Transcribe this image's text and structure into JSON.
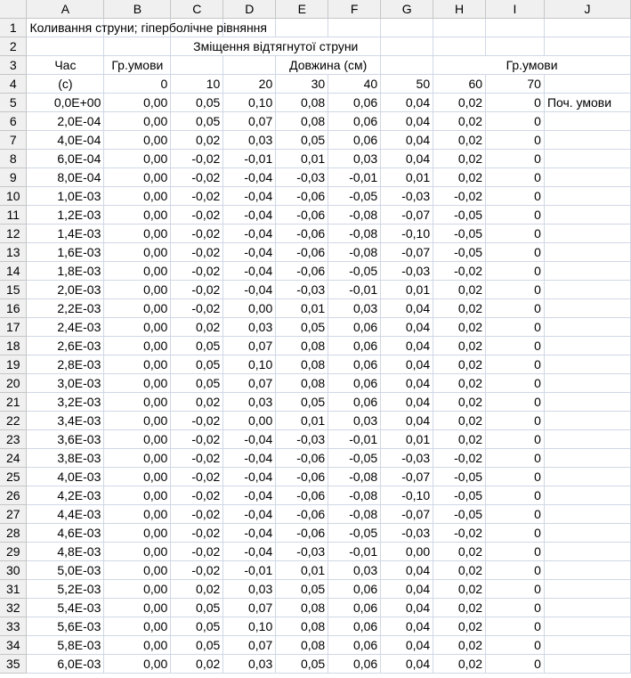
{
  "columns": [
    "A",
    "B",
    "C",
    "D",
    "E",
    "F",
    "G",
    "H",
    "I",
    "J"
  ],
  "title_row": {
    "text": "Коливання струни; гіперболічне рівняння"
  },
  "row2": {
    "text": "Зміщення відтягнутої струни"
  },
  "row3": {
    "a": "Час",
    "b": "Гр.умови",
    "e": "Довжина (см)",
    "h": "Гр.умови"
  },
  "row4": {
    "a": "(с)",
    "b": "0",
    "c": "10",
    "d": "20",
    "e": "30",
    "f": "40",
    "g": "50",
    "h": "60",
    "i": "70"
  },
  "note_initial": "Поч. умови",
  "data_rows": [
    [
      "0,0E+00",
      "0,00",
      "0,05",
      "0,10",
      "0,08",
      "0,06",
      "0,04",
      "0,02",
      "0"
    ],
    [
      "2,0E-04",
      "0,00",
      "0,05",
      "0,07",
      "0,08",
      "0,06",
      "0,04",
      "0,02",
      "0"
    ],
    [
      "4,0E-04",
      "0,00",
      "0,02",
      "0,03",
      "0,05",
      "0,06",
      "0,04",
      "0,02",
      "0"
    ],
    [
      "6,0E-04",
      "0,00",
      "-0,02",
      "-0,01",
      "0,01",
      "0,03",
      "0,04",
      "0,02",
      "0"
    ],
    [
      "8,0E-04",
      "0,00",
      "-0,02",
      "-0,04",
      "-0,03",
      "-0,01",
      "0,01",
      "0,02",
      "0"
    ],
    [
      "1,0E-03",
      "0,00",
      "-0,02",
      "-0,04",
      "-0,06",
      "-0,05",
      "-0,03",
      "-0,02",
      "0"
    ],
    [
      "1,2E-03",
      "0,00",
      "-0,02",
      "-0,04",
      "-0,06",
      "-0,08",
      "-0,07",
      "-0,05",
      "0"
    ],
    [
      "1,4E-03",
      "0,00",
      "-0,02",
      "-0,04",
      "-0,06",
      "-0,08",
      "-0,10",
      "-0,05",
      "0"
    ],
    [
      "1,6E-03",
      "0,00",
      "-0,02",
      "-0,04",
      "-0,06",
      "-0,08",
      "-0,07",
      "-0,05",
      "0"
    ],
    [
      "1,8E-03",
      "0,00",
      "-0,02",
      "-0,04",
      "-0,06",
      "-0,05",
      "-0,03",
      "-0,02",
      "0"
    ],
    [
      "2,0E-03",
      "0,00",
      "-0,02",
      "-0,04",
      "-0,03",
      "-0,01",
      "0,01",
      "0,02",
      "0"
    ],
    [
      "2,2E-03",
      "0,00",
      "-0,02",
      "0,00",
      "0,01",
      "0,03",
      "0,04",
      "0,02",
      "0"
    ],
    [
      "2,4E-03",
      "0,00",
      "0,02",
      "0,03",
      "0,05",
      "0,06",
      "0,04",
      "0,02",
      "0"
    ],
    [
      "2,6E-03",
      "0,00",
      "0,05",
      "0,07",
      "0,08",
      "0,06",
      "0,04",
      "0,02",
      "0"
    ],
    [
      "2,8E-03",
      "0,00",
      "0,05",
      "0,10",
      "0,08",
      "0,06",
      "0,04",
      "0,02",
      "0"
    ],
    [
      "3,0E-03",
      "0,00",
      "0,05",
      "0,07",
      "0,08",
      "0,06",
      "0,04",
      "0,02",
      "0"
    ],
    [
      "3,2E-03",
      "0,00",
      "0,02",
      "0,03",
      "0,05",
      "0,06",
      "0,04",
      "0,02",
      "0"
    ],
    [
      "3,4E-03",
      "0,00",
      "-0,02",
      "0,00",
      "0,01",
      "0,03",
      "0,04",
      "0,02",
      "0"
    ],
    [
      "3,6E-03",
      "0,00",
      "-0,02",
      "-0,04",
      "-0,03",
      "-0,01",
      "0,01",
      "0,02",
      "0"
    ],
    [
      "3,8E-03",
      "0,00",
      "-0,02",
      "-0,04",
      "-0,06",
      "-0,05",
      "-0,03",
      "-0,02",
      "0"
    ],
    [
      "4,0E-03",
      "0,00",
      "-0,02",
      "-0,04",
      "-0,06",
      "-0,08",
      "-0,07",
      "-0,05",
      "0"
    ],
    [
      "4,2E-03",
      "0,00",
      "-0,02",
      "-0,04",
      "-0,06",
      "-0,08",
      "-0,10",
      "-0,05",
      "0"
    ],
    [
      "4,4E-03",
      "0,00",
      "-0,02",
      "-0,04",
      "-0,06",
      "-0,08",
      "-0,07",
      "-0,05",
      "0"
    ],
    [
      "4,6E-03",
      "0,00",
      "-0,02",
      "-0,04",
      "-0,06",
      "-0,05",
      "-0,03",
      "-0,02",
      "0"
    ],
    [
      "4,8E-03",
      "0,00",
      "-0,02",
      "-0,04",
      "-0,03",
      "-0,01",
      "0,00",
      "0,02",
      "0"
    ],
    [
      "5,0E-03",
      "0,00",
      "-0,02",
      "-0,01",
      "0,01",
      "0,03",
      "0,04",
      "0,02",
      "0"
    ],
    [
      "5,2E-03",
      "0,00",
      "0,02",
      "0,03",
      "0,05",
      "0,06",
      "0,04",
      "0,02",
      "0"
    ],
    [
      "5,4E-03",
      "0,00",
      "0,05",
      "0,07",
      "0,08",
      "0,06",
      "0,04",
      "0,02",
      "0"
    ],
    [
      "5,6E-03",
      "0,00",
      "0,05",
      "0,10",
      "0,08",
      "0,06",
      "0,04",
      "0,02",
      "0"
    ],
    [
      "5,8E-03",
      "0,00",
      "0,05",
      "0,07",
      "0,08",
      "0,06",
      "0,04",
      "0,02",
      "0"
    ],
    [
      "6,0E-03",
      "0,00",
      "0,02",
      "0,03",
      "0,05",
      "0,06",
      "0,04",
      "0,02",
      "0"
    ]
  ]
}
